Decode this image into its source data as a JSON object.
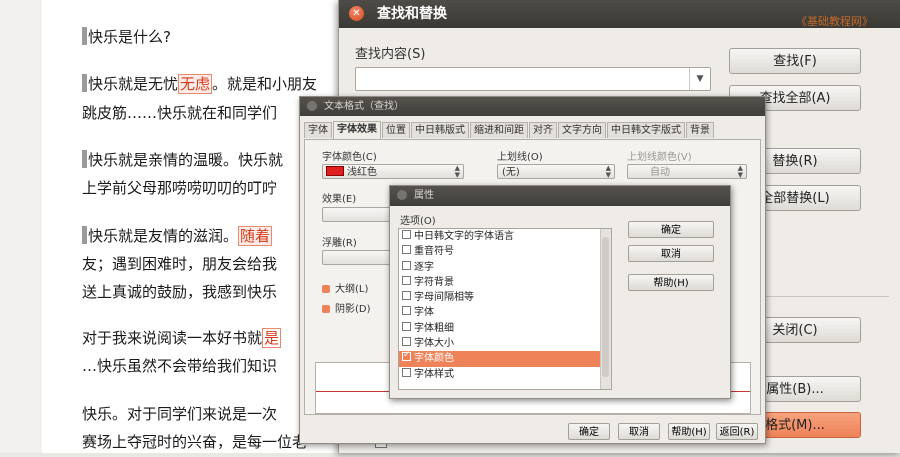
{
  "document": {
    "paragraphs": [
      {
        "pre": "快乐是什么?",
        "hl": "",
        "post": ""
      },
      {
        "pre": "快乐就是无忧",
        "hl": "无虑",
        "post": "。就是和小朋友"
      },
      {
        "pre": "跳皮筋……快乐就在和同学们",
        "hl": "",
        "post": ""
      },
      {
        "pre": "快乐就是亲情的温暖。快乐就",
        "hl": "",
        "post": ""
      },
      {
        "pre": "上学前父母那唠唠叨叨的叮咛",
        "hl": "",
        "post": ""
      },
      {
        "pre": "快乐就是友情的滋润。",
        "hl": "随着",
        "post": ""
      },
      {
        "pre": "友；遇到困难时，朋友会给我",
        "hl": "",
        "post": ""
      },
      {
        "pre": "送上真诚的鼓励，我感到快乐",
        "hl": "",
        "post": ""
      },
      {
        "pre": "对于我来说阅读一本好书就",
        "hl": "是",
        "post": ""
      },
      {
        "pre": "…快乐虽然不会带给我们知识",
        "hl": "",
        "post": ""
      },
      {
        "pre": "快乐。对于同学们来说是一次",
        "hl": "",
        "post": ""
      },
      {
        "pre": "赛场上夺冠时的兴奋，是每一位老",
        "hl": "",
        "post": ""
      }
    ]
  },
  "find_replace": {
    "title": "查找和替换",
    "watermark": "《基础教程网》",
    "search_label": "查找内容(S)",
    "search_value": "",
    "buttons": {
      "find": "查找(F)",
      "find_all": "查找全部(A)",
      "replace": "替换(R)",
      "replace_all": "全部替换(L)",
      "close": "关闭(C)",
      "attributes": "属性(B)...",
      "format": "格式(M)..."
    }
  },
  "text_format": {
    "title": "文本格式（查找）",
    "tabs": [
      "字体",
      "字体效果",
      "位置",
      "中日韩版式",
      "缩进和间距",
      "对齐",
      "文字方向",
      "中日韩文字版式",
      "背景"
    ],
    "font_color_label": "字体颜色(C)",
    "font_color_value": "浅红色",
    "font_color_hex": "#e02020",
    "underline_label": "上划线(O)",
    "underline_value": "(无)",
    "underline_color_label": "上划线颜色(V)",
    "underline_color_value": "自动",
    "effects_label": "效果(E)",
    "relief_label": "浮雕(R)",
    "outline_label": "大纲(L)",
    "shadow_label": "阴影(D)",
    "buttons": {
      "ok": "确定",
      "cancel": "取消",
      "help": "帮助(H)",
      "back": "返回(R)"
    }
  },
  "properties": {
    "title": "属性",
    "options_label": "选项(O)",
    "items": [
      {
        "label": "中日韩文字的字体语言",
        "checked": false,
        "selected": false
      },
      {
        "label": "重音符号",
        "checked": false,
        "selected": false
      },
      {
        "label": "逐字",
        "checked": false,
        "selected": false
      },
      {
        "label": "字符背景",
        "checked": false,
        "selected": false
      },
      {
        "label": "字母间隔相等",
        "checked": false,
        "selected": false
      },
      {
        "label": "字体",
        "checked": false,
        "selected": false
      },
      {
        "label": "字体粗细",
        "checked": false,
        "selected": false
      },
      {
        "label": "字体大小",
        "checked": false,
        "selected": false
      },
      {
        "label": "字体颜色",
        "checked": true,
        "selected": true
      },
      {
        "label": "字体样式",
        "checked": false,
        "selected": false
      }
    ],
    "buttons": {
      "ok": "确定",
      "cancel": "取消",
      "help": "帮助(H)"
    }
  },
  "colors": {
    "accent": "#ee8258",
    "highlight_text": "#d63c1a"
  }
}
